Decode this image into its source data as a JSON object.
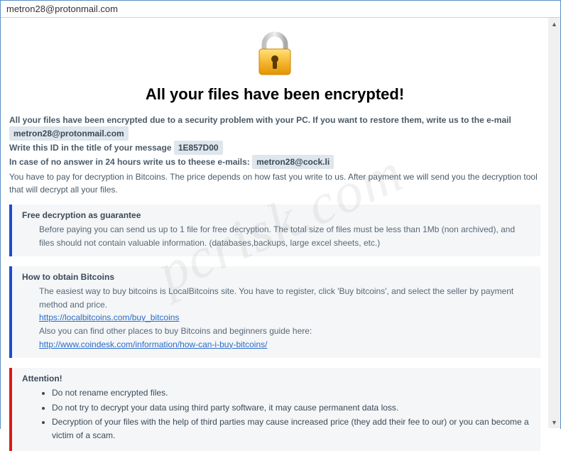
{
  "window": {
    "title": "metron28@protonmail.com"
  },
  "heading": "All your files have been encrypted!",
  "intro": {
    "line1_pre": "All your files have been encrypted due to a security problem with your PC. If you want to restore them, write us to the e-mail",
    "email1": "metron28@protonmail.com",
    "line2_pre": "Write this ID in the title of your message",
    "id": "1E857D00",
    "line3_pre": "In case of no answer in 24 hours write us to theese e-mails:",
    "email2": "metron28@cock.li",
    "pay_note": "You have to pay for decryption in Bitcoins. The price depends on how fast you write to us. After payment we will send you the decryption tool that will decrypt all your files."
  },
  "sections": {
    "free": {
      "title": "Free decryption as guarantee",
      "body": "Before paying you can send us up to 1 file for free decryption. The total size of files must be less than 1Mb (non archived), and files should not contain valuable information. (databases,backups, large excel sheets, etc.)"
    },
    "obtain": {
      "title": "How to obtain Bitcoins",
      "l1": "The easiest way to buy bitcoins is LocalBitcoins site. You have to register, click 'Buy bitcoins', and select the seller by payment method and price.",
      "link1": "https://localbitcoins.com/buy_bitcoins",
      "l2": "Also you can find other places to buy Bitcoins and beginners guide here:",
      "link2": "http://www.coindesk.com/information/how-can-i-buy-bitcoins/"
    },
    "attention": {
      "title": "Attention!",
      "b1": "Do not rename encrypted files.",
      "b2": "Do not try to decrypt your data using third party software, it may cause permanent data loss.",
      "b3": "Decryption of your files with the help of third parties may cause increased price (they add their fee to our) or you can become a victim of a scam."
    }
  },
  "watermark": "pcrisk.com"
}
